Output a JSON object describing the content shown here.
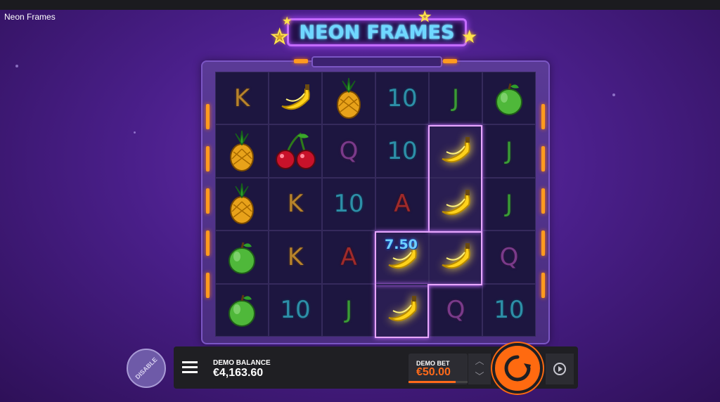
{
  "window": {
    "title": "Neon Frames"
  },
  "logo": {
    "text": "NEON FRAMES"
  },
  "grid": {
    "rows": [
      [
        "K",
        "banana",
        "pineapple",
        "10",
        "J",
        "apple"
      ],
      [
        "pineapple",
        "cherry",
        "Q",
        "10",
        "banana",
        "J"
      ],
      [
        "pineapple",
        "K",
        "10",
        "A",
        "banana",
        "J"
      ],
      [
        "apple",
        "K",
        "A",
        "banana",
        "banana",
        "Q"
      ],
      [
        "apple",
        "10",
        "J",
        "banana",
        "Q",
        "10"
      ]
    ],
    "win_amount": "7.50"
  },
  "controls": {
    "disable_label": "DISABLE",
    "balance_label": "DEMO BALANCE",
    "balance_value": "€4,163.60",
    "bet_label": "DEMO BET",
    "bet_value": "€50.00",
    "bet_level_fraction": 0.8,
    "up_arrow": "︿",
    "down_arrow": "﹀"
  },
  "icons": {
    "menu": "menu-icon",
    "spin": "spin-icon",
    "autoplay": "autoplay-icon"
  },
  "colors": {
    "accent": "#ff6a10",
    "neon_purple": "#c46bff",
    "logo_blue": "#6fd8ff"
  }
}
